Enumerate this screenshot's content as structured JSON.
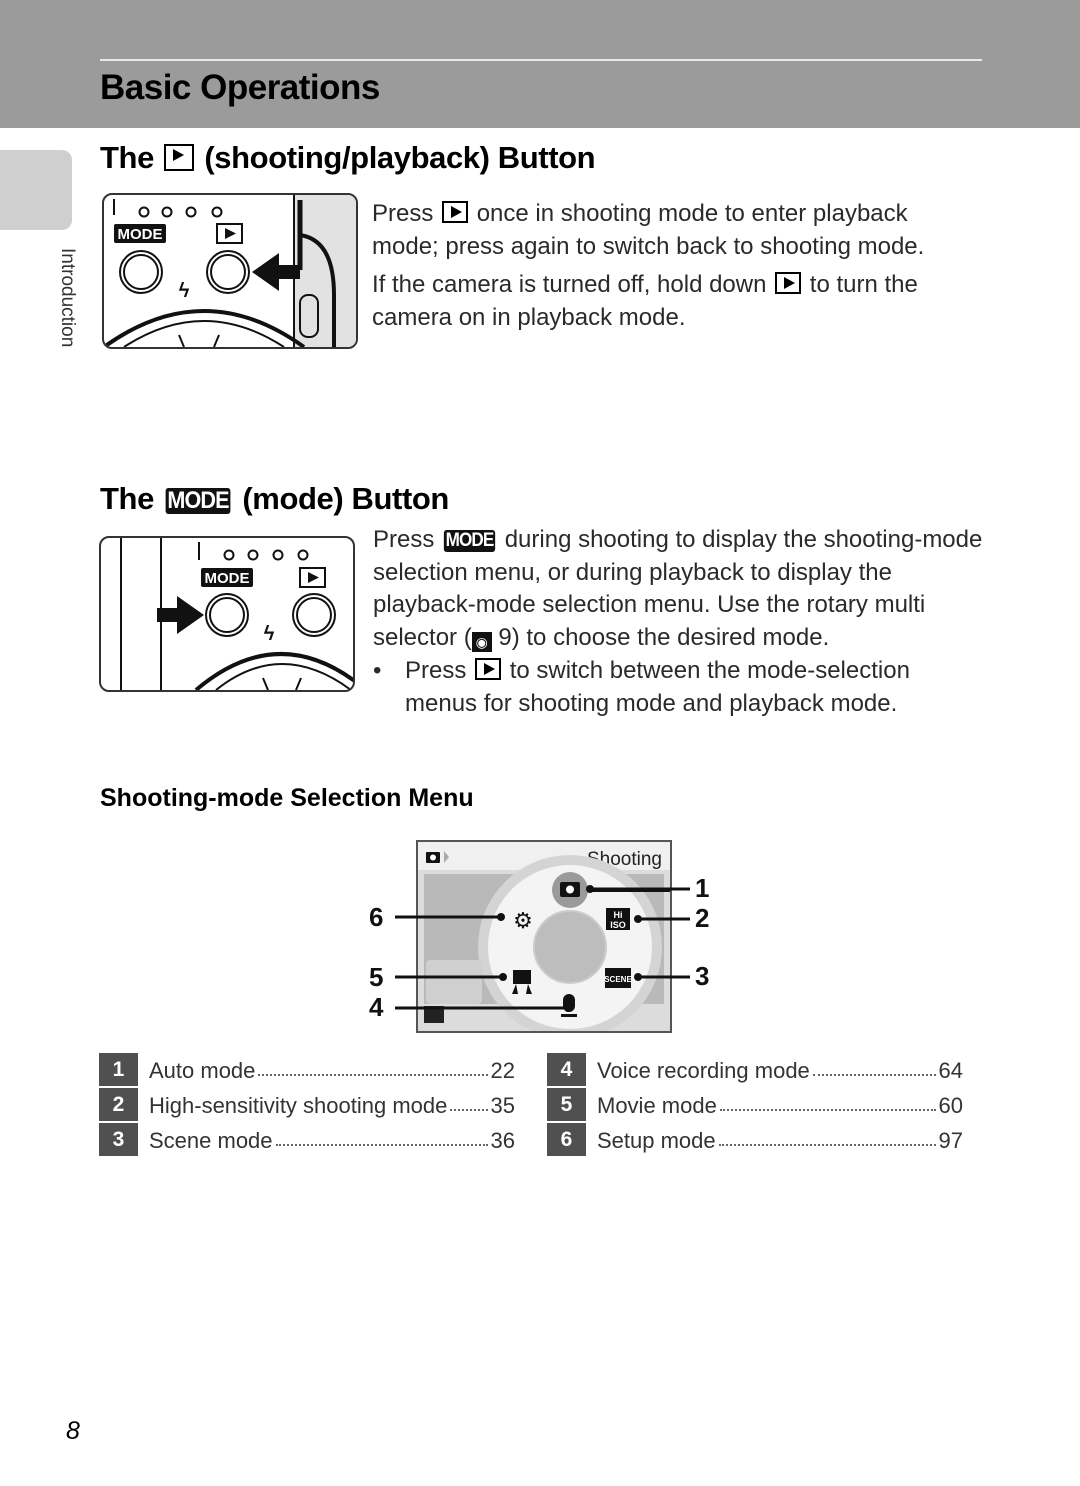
{
  "header": {
    "title": "Basic Operations"
  },
  "side_tab": {
    "label": "Introduction"
  },
  "section1": {
    "title_prefix": "The",
    "title_icon": "playback-button-icon",
    "title_suffix": "(shooting/playback) Button",
    "para1_a": "Press",
    "para1_b": "once in shooting mode to enter playback mode; press again to switch back to shooting mode.",
    "para2_a": "If the camera is turned off, hold down",
    "para2_b": "to turn the camera on in playback mode."
  },
  "section2": {
    "title_prefix": "The",
    "title_badge": "MODE",
    "title_suffix": "(mode) Button",
    "para_a": "Press",
    "para_badge": "MODE",
    "para_b": "during shooting to display the shooting-mode selection menu, or during playback to display the playback-mode selection menu. Use the rotary multi selector (",
    "para_ref_icon": "eye-reference-icon",
    "para_c": "9) to choose the desired mode.",
    "bullet_a": "Press",
    "bullet_b": "to switch between the mode-selection menus for shooting mode and playback mode."
  },
  "illustration": {
    "mode_label": "MODE",
    "screen_title": "Shooting",
    "callouts": [
      "1",
      "2",
      "3",
      "4",
      "5",
      "6"
    ]
  },
  "section3": {
    "title": "Shooting-mode Selection Menu",
    "items": [
      {
        "num": "1",
        "label": "Auto mode",
        "page": "22"
      },
      {
        "num": "2",
        "label": "High-sensitivity shooting mode",
        "page": "35"
      },
      {
        "num": "3",
        "label": "Scene mode",
        "page": "36"
      },
      {
        "num": "4",
        "label": "Voice recording mode",
        "page": "64"
      },
      {
        "num": "5",
        "label": "Movie mode",
        "page": "60"
      },
      {
        "num": "6",
        "label": "Setup mode",
        "page": "97"
      }
    ]
  },
  "footer": {
    "page_number": "8"
  }
}
